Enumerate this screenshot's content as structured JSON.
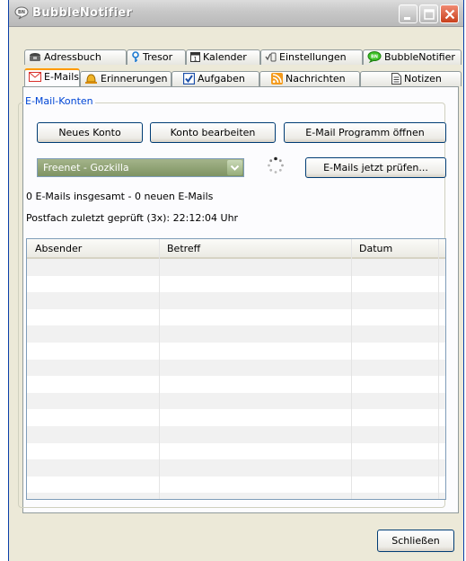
{
  "window": {
    "title": "BubbleNotifier"
  },
  "tabs_top": [
    {
      "label": "Adressbuch",
      "icon": "phone-icon"
    },
    {
      "label": "Tresor",
      "icon": "key-icon"
    },
    {
      "label": "Kalender",
      "icon": "calendar-icon"
    },
    {
      "label": "Einstellungen",
      "icon": "settings-icon"
    },
    {
      "label": "BubbleNotifier",
      "icon": "bubble-icon"
    }
  ],
  "tabs_bottom": [
    {
      "label": "E-Mails",
      "icon": "mail-icon",
      "active": true
    },
    {
      "label": "Erinnerungen",
      "icon": "bell-icon"
    },
    {
      "label": "Aufgaben",
      "icon": "checkbox-icon"
    },
    {
      "label": "Nachrichten",
      "icon": "rss-icon"
    },
    {
      "label": "Notizen",
      "icon": "note-icon"
    }
  ],
  "accounts": {
    "group_label": "E-Mail-Konten",
    "new_account": "Neues Konto",
    "edit_account": "Konto bearbeiten",
    "open_program": "E-Mail Programm öffnen",
    "selected_account": "Freenet - Gozkilla",
    "check_now": "E-Mails jetzt prüfen..."
  },
  "status": {
    "summary": "0 E-Mails insgesamt - 0 neuen E-Mails",
    "last_checked": "Postfach zuletzt geprüft (3x): 22:12:04 Uhr"
  },
  "mail_list": {
    "columns": [
      "Absender",
      "Betreff",
      "Datum"
    ],
    "rows": []
  },
  "footer": {
    "close": "Schließen"
  },
  "colors": {
    "tab_active_accent": "#ff9a00",
    "group_label": "#0046d5",
    "combo_bg": "#8fa174"
  }
}
